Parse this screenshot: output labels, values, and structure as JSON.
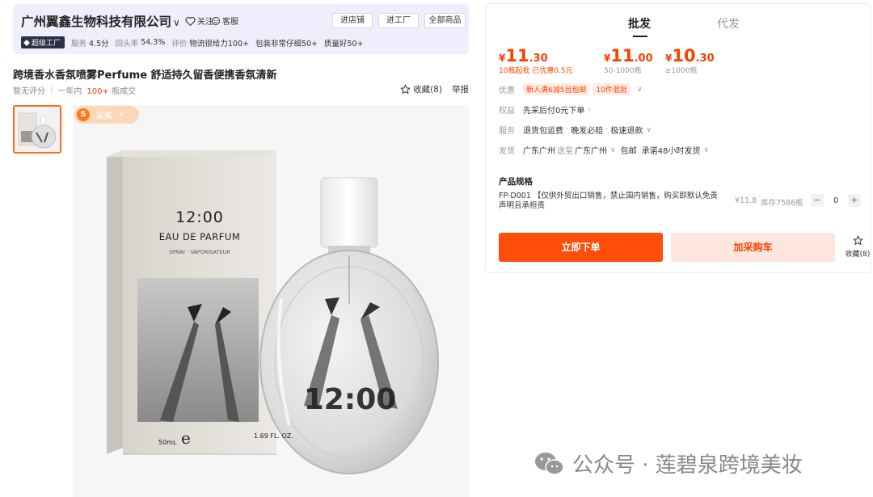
{
  "store": {
    "name": "广州翼鑫生物科技有限公司",
    "chevron": "∨",
    "follow_label": "关注",
    "service_label": "客服",
    "buttons": [
      "进店铺",
      "进工厂",
      "全部商品"
    ],
    "badge": "超级工厂",
    "metrics": [
      {
        "label": "服务",
        "value": "4.5分"
      },
      {
        "label": "回头率",
        "value": "54.3%"
      },
      {
        "label": "评价",
        "value": "物流很给力100+"
      }
    ],
    "tags": [
      "包装非常仔细50+",
      "质量好50+"
    ]
  },
  "product": {
    "title": "跨境香水香氛喷雾Perfume 舒适持久留香便携香氛清新",
    "rating": "暂无评分",
    "period": "一年内",
    "sold_count": "100+",
    "sold_unit": "瓶成交",
    "favorite": "收藏(8)",
    "report": "举报",
    "collect_badge": "采集",
    "box_text": {
      "time": "12:00",
      "line1": "EAU DE PARFUM",
      "line2": "SPRAY · VAPORISATEUR",
      "volume": "50mL",
      "logo": "e",
      "floz": "1.69 FL. OZ."
    },
    "bottle_text": "12:00"
  },
  "panel": {
    "tabs": [
      "批发",
      "代发"
    ],
    "tiers": [
      {
        "yen": "¥",
        "int": "11",
        "dec": ".30",
        "note": "10瓶起批 已优惠0.5元"
      },
      {
        "yen": "¥",
        "int": "11",
        "dec": ".00",
        "note": "50-1000瓶"
      },
      {
        "yen": "¥",
        "int": "10",
        "dec": ".30",
        "note": "≥1000瓶"
      }
    ],
    "discount": {
      "key": "优惠",
      "tags": [
        "新人满6减5且包邮",
        "10件混批"
      ]
    },
    "rights": {
      "key": "权益",
      "value": "先采后付0元下单"
    },
    "service": {
      "key": "服务",
      "items": [
        "退货包运费",
        "晚发必赔",
        "极速退款"
      ]
    },
    "shipping": {
      "key": "发货",
      "from": "广东广州",
      "to_label": "送至",
      "to": "广东广州",
      "free": "包邮",
      "promise": "承诺48小时发货"
    },
    "spec": {
      "title": "产品规格",
      "name": "FP-D001 【仅供外贸出口销售，禁止国内销售，购买即默认免责声明且承担责",
      "price": "¥11.8",
      "stock": "库存7586瓶",
      "minus": "−",
      "qty": "0",
      "plus": "+"
    },
    "buy_label": "立即下单",
    "cart_label": "加采购车",
    "side_fav": "收藏(8)"
  },
  "watermark": "公众号 · 莲碧泉跨境美妆"
}
